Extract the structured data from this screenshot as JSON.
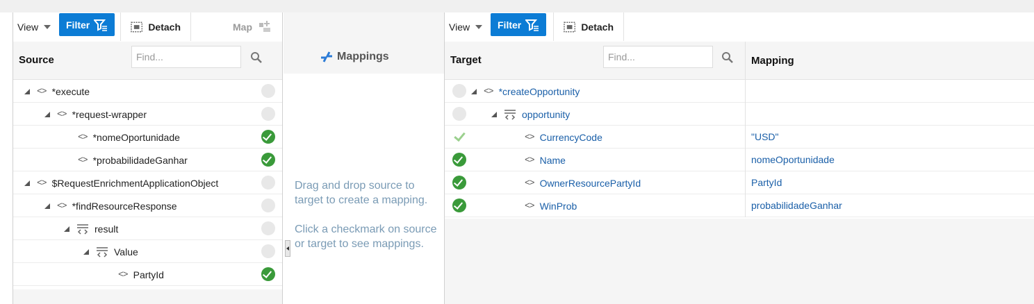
{
  "colors": {
    "accent": "#0c7cd5",
    "link": "#1a5fa8",
    "mapped_check": "#3a9a3a",
    "hint_text": "#7a9bb5"
  },
  "source": {
    "toolbar": {
      "view_label": "View",
      "filter_label": "Filter",
      "detach_label": "Detach",
      "map_label": "Map"
    },
    "header_title": "Source",
    "find_placeholder": "Find...",
    "rows": [
      {
        "label": "*execute",
        "status": "empty"
      },
      {
        "label": "*request-wrapper",
        "status": "empty"
      },
      {
        "label": "*nomeOportunidade",
        "status": "mapped"
      },
      {
        "label": "*probabilidadeGanhar",
        "status": "mapped"
      },
      {
        "label": "$RequestEnrichmentApplicationObject",
        "status": "empty"
      },
      {
        "label": "*findResourceResponse",
        "status": "empty"
      },
      {
        "label": "result",
        "status": "empty"
      },
      {
        "label": "Value",
        "status": "empty"
      },
      {
        "label": "PartyId",
        "status": "mapped"
      }
    ]
  },
  "middle": {
    "title": "Mappings",
    "hint1": "Drag and drop source to target to create a mapping.",
    "hint2": "Click a checkmark on source or target to see mappings."
  },
  "target": {
    "toolbar": {
      "view_label": "View",
      "filter_label": "Filter",
      "detach_label": "Detach"
    },
    "header_title": "Target",
    "find_placeholder": "Find...",
    "mapping_header": "Mapping",
    "rows": [
      {
        "label": "*createOpportunity",
        "mapping": "",
        "status": "empty"
      },
      {
        "label": "opportunity",
        "mapping": "",
        "status": "empty"
      },
      {
        "label": "CurrencyCode",
        "mapping": "\"USD\"",
        "status": "literal"
      },
      {
        "label": "Name",
        "mapping": "nomeOportunidade",
        "status": "mapped"
      },
      {
        "label": "OwnerResourcePartyId",
        "mapping": "PartyId",
        "status": "mapped"
      },
      {
        "label": "WinProb",
        "mapping": "probabilidadeGanhar",
        "status": "mapped"
      }
    ]
  },
  "icons": {
    "search": "search-icon",
    "filter": "filter-icon",
    "detach": "detach-icon",
    "map": "map-icon",
    "element": "element-icon",
    "collection": "collection-icon",
    "expand": "expanded-triangle-icon",
    "mappings": "mappings-icon"
  }
}
